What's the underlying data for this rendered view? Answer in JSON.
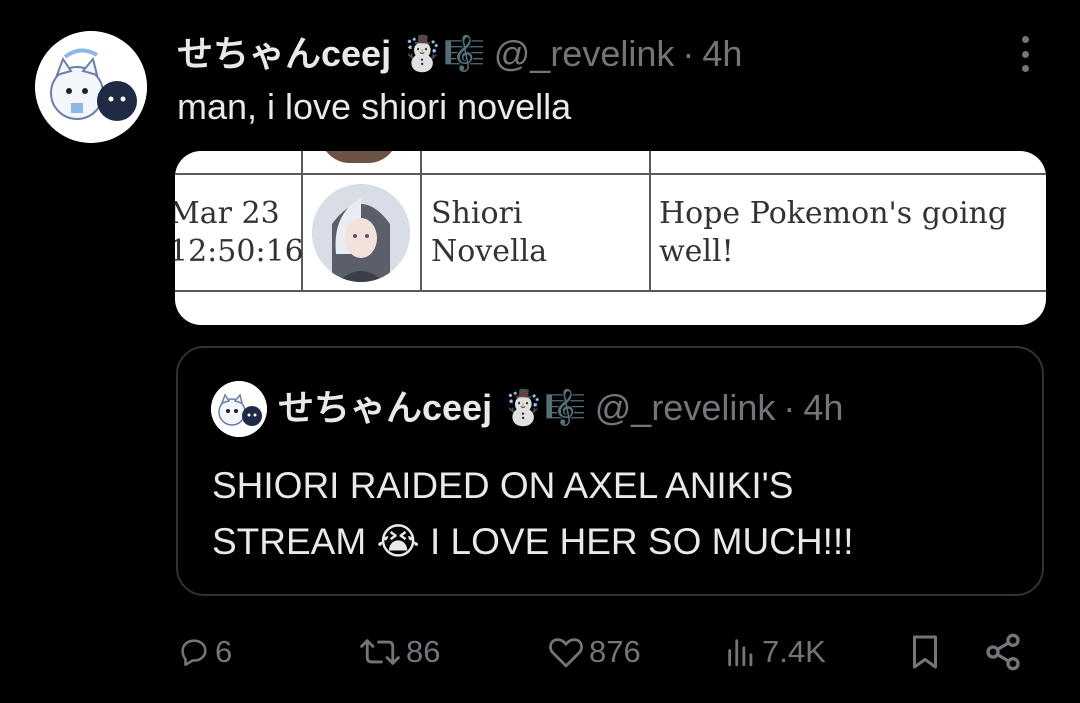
{
  "tweet": {
    "display_name": "せちゃんceej",
    "name_emoji": "☃️🎼",
    "handle": "@_revelink",
    "separator": "·",
    "time": "4h",
    "text": "man, i love shiori novella"
  },
  "media": {
    "date_line1": "Mar 23",
    "date_line2": "12:50:16",
    "name_line1": "Shiori",
    "name_line2": "Novella",
    "message_line1": "Hope Pokemon's going",
    "message_line2": "well!"
  },
  "quote": {
    "display_name": "せちゃんceej",
    "name_emoji": "☃️🎼",
    "handle": "@_revelink",
    "separator": "·",
    "time": "4h",
    "text_line1": "SHIORI RAIDED ON AXEL ANIKI'S",
    "text_line2": "STREAM 😭 I LOVE HER SO MUCH!!!"
  },
  "actions": {
    "replies": "6",
    "reposts": "86",
    "likes": "876",
    "views": "7.4K"
  },
  "icons": {
    "reply": "reply-icon",
    "repost": "repost-icon",
    "like": "heart-icon",
    "views": "views-icon",
    "bookmark": "bookmark-icon",
    "share": "share-icon",
    "more": "more-icon"
  },
  "colors": {
    "background": "#000000",
    "text": "#e7e9ea",
    "muted": "#71767b",
    "border": "#2f3336"
  }
}
